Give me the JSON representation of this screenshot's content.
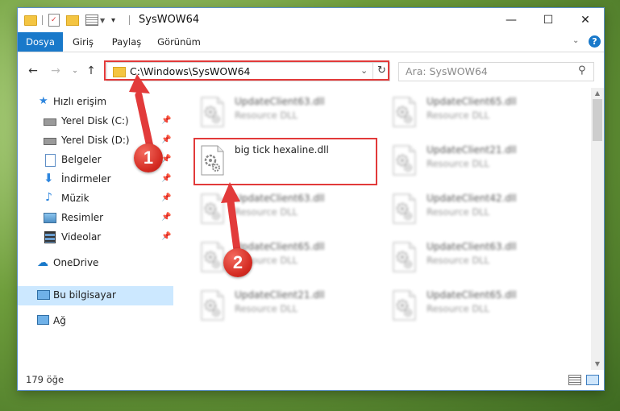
{
  "window": {
    "title": "SysWOW64",
    "minimize": "—",
    "maximize": "☐",
    "close": "✕"
  },
  "ribbon": {
    "tabs": [
      {
        "label": "Dosya",
        "active": true
      },
      {
        "label": "Giriş",
        "active": false
      },
      {
        "label": "Paylaş",
        "active": false
      },
      {
        "label": "Görünüm",
        "active": false
      }
    ]
  },
  "address": {
    "path": "C:\\Windows\\SysWOW64",
    "search_placeholder": "Ara: SysWOW64"
  },
  "sidebar": {
    "items": [
      {
        "label": "Hızlı erişim",
        "icon": "star-icon",
        "pinned": false
      },
      {
        "label": "Yerel Disk (C:)",
        "icon": "drive-icon",
        "pinned": true
      },
      {
        "label": "Yerel Disk (D:)",
        "icon": "drive-icon",
        "pinned": true
      },
      {
        "label": "Belgeler",
        "icon": "documents-icon",
        "pinned": true
      },
      {
        "label": "İndirmeler",
        "icon": "download-icon",
        "pinned": true
      },
      {
        "label": "Müzik",
        "icon": "music-icon",
        "pinned": true
      },
      {
        "label": "Resimler",
        "icon": "pictures-icon",
        "pinned": true
      },
      {
        "label": "Videolar",
        "icon": "video-icon",
        "pinned": true
      },
      {
        "label": "OneDrive",
        "icon": "cloud-icon",
        "pinned": false
      },
      {
        "label": "Bu bilgisayar",
        "icon": "computer-icon",
        "pinned": false,
        "selected": true
      },
      {
        "label": "Ağ",
        "icon": "network-icon",
        "pinned": false
      }
    ]
  },
  "files": [
    {
      "name": "UpdateClient63.dll",
      "type": "Resource DLL",
      "blurred": true
    },
    {
      "name": "UpdateClient65.dll",
      "type": "Resource DLL",
      "blurred": true
    },
    {
      "name": "big tick hexaline.dll",
      "type": "",
      "blurred": false
    },
    {
      "name": "UpdateClient21.dll",
      "type": "Resource DLL",
      "blurred": true
    },
    {
      "name": "UpdateClient63.dll",
      "type": "Resource DLL",
      "blurred": true
    },
    {
      "name": "UpdateClient42.dll",
      "type": "Resource DLL",
      "blurred": true
    },
    {
      "name": "UpdateClient65.dll",
      "type": "Resource DLL",
      "blurred": true
    },
    {
      "name": "UpdateClient63.dll",
      "type": "Resource DLL",
      "blurred": true
    },
    {
      "name": "UpdateClient21.dll",
      "type": "Resource DLL",
      "blurred": true
    },
    {
      "name": "UpdateClient65.dll",
      "type": "Resource DLL",
      "blurred": true
    }
  ],
  "status": {
    "count": "179 öğe"
  },
  "annotations": {
    "step1": "1",
    "step2": "2",
    "color": "#e23a3a"
  }
}
